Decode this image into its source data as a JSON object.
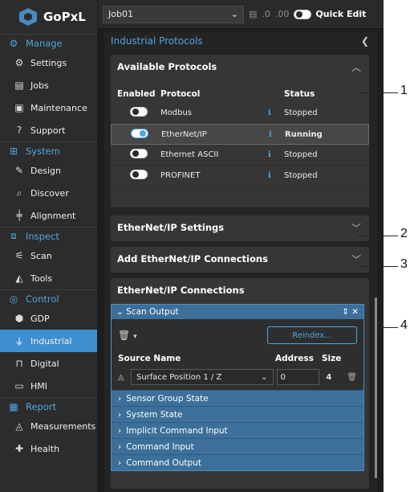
{
  "app": {
    "name": "GoPxL"
  },
  "sidebar": {
    "sections": [
      {
        "label": "Manage",
        "items": [
          {
            "label": "Settings"
          },
          {
            "label": "Jobs"
          },
          {
            "label": "Maintenance"
          },
          {
            "label": "Support"
          }
        ]
      },
      {
        "label": "System",
        "items": [
          {
            "label": "Design"
          },
          {
            "label": "Discover"
          },
          {
            "label": "Alignment"
          }
        ]
      },
      {
        "label": "Inspect",
        "items": [
          {
            "label": "Scan"
          },
          {
            "label": "Tools"
          }
        ]
      },
      {
        "label": "Control",
        "items": [
          {
            "label": "GDP"
          },
          {
            "label": "Industrial"
          },
          {
            "label": "Digital"
          },
          {
            "label": "HMI"
          }
        ]
      },
      {
        "label": "Report",
        "items": [
          {
            "label": "Measurements"
          },
          {
            "label": "Health"
          }
        ]
      }
    ],
    "active": "Industrial"
  },
  "toolbar": {
    "job": "Job01",
    "quick_edit": "Quick Edit",
    "quick_edit_on": false
  },
  "panel": {
    "title": "Industrial Protocols",
    "available": {
      "title": "Available Protocols",
      "headers": {
        "enabled": "Enabled",
        "protocol": "Protocol",
        "status": "Status"
      },
      "rows": [
        {
          "protocol": "Modbus",
          "status": "Stopped",
          "enabled": false
        },
        {
          "protocol": "EtherNet/IP",
          "status": "Running",
          "enabled": true
        },
        {
          "protocol": "Ethernet ASCII",
          "status": "Stopped",
          "enabled": false
        },
        {
          "protocol": "PROFINET",
          "status": "Stopped",
          "enabled": false
        }
      ]
    },
    "eip_settings": {
      "title": "EtherNet/IP Settings"
    },
    "add_connections": {
      "title": "Add EtherNet/IP Connections"
    },
    "connections": {
      "title": "EtherNet/IP Connections",
      "scan_output": {
        "title": "Scan Output",
        "reindex": "Reindex...",
        "headers": {
          "source": "Source Name",
          "address": "Address",
          "size": "Size"
        },
        "source_value": "Surface Position 1 / Z",
        "address_value": "0",
        "size_value": "4"
      },
      "collapsed": [
        "Sensor Group State",
        "System State",
        "Implicit Command Input",
        "Command Input",
        "Command Output"
      ]
    }
  },
  "annotations": [
    "1",
    "2",
    "3",
    "4"
  ],
  "colors": {
    "accent": "#4ea6e0",
    "active_nav": "#3d8fd0",
    "header_blue": "#3c6f99"
  }
}
